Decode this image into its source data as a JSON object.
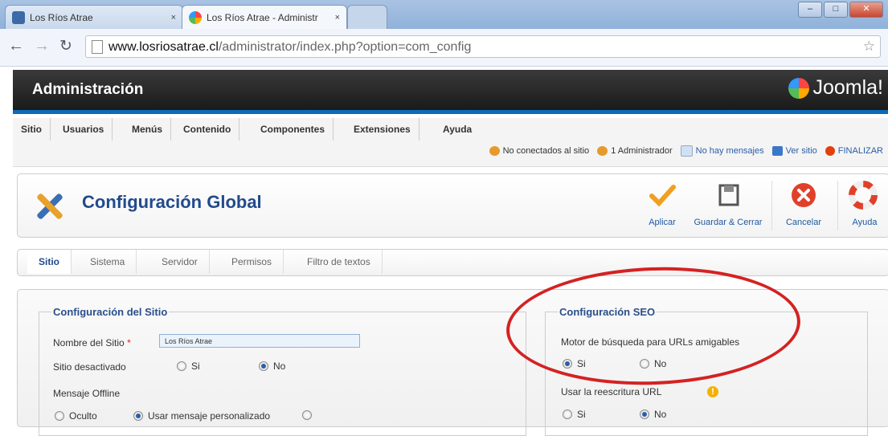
{
  "browser": {
    "tabs": [
      {
        "label": "Los Ríos Atrae",
        "close": "×"
      },
      {
        "label": "Los Ríos Atrae - Administr",
        "close": "×"
      }
    ],
    "url_host": "www.losriosatrae.cl",
    "url_path": "/administrator/index.php?option=com_config"
  },
  "header": {
    "title": "Administración",
    "logo_text": "Joomla!"
  },
  "menu": {
    "items": [
      "Sitio",
      "Usuarios",
      "Menús",
      "Contenido",
      "Componentes",
      "Extensiones",
      "Ayuda"
    ]
  },
  "status": {
    "not_connected": "No conectados al sitio",
    "admins": "1 Administrador",
    "messages": "No hay mensajes",
    "view_site": "Ver sitio",
    "logout": "FINALIZAR"
  },
  "toolbar": {
    "title": "Configuración Global",
    "apply": "Aplicar",
    "save_close": "Guardar & Cerrar",
    "cancel": "Cancelar",
    "help": "Ayuda"
  },
  "subtabs": [
    "Sitio",
    "Sistema",
    "Servidor",
    "Permisos",
    "Filtro de textos"
  ],
  "site_config": {
    "legend": "Configuración del Sitio",
    "site_name_label": "Nombre del Sitio",
    "required_mark": "*",
    "site_name_value": "Los Ríos Atrae",
    "offline_label": "Sitio desactivado",
    "yes": "Si",
    "no": "No",
    "offline_msg_label": "Mensaje Offline",
    "hidden": "Oculto",
    "custom_msg": "Usar mensaje personalizado"
  },
  "seo_config": {
    "legend": "Configuración SEO",
    "sef_label": "Motor de búsqueda para URLs amigables",
    "rewrite_label": "Usar la reescritura URL",
    "yes": "Si",
    "no": "No"
  },
  "colors": {
    "accent": "#0e6bb8",
    "annotation": "#d42222",
    "title": "#214b8b"
  }
}
